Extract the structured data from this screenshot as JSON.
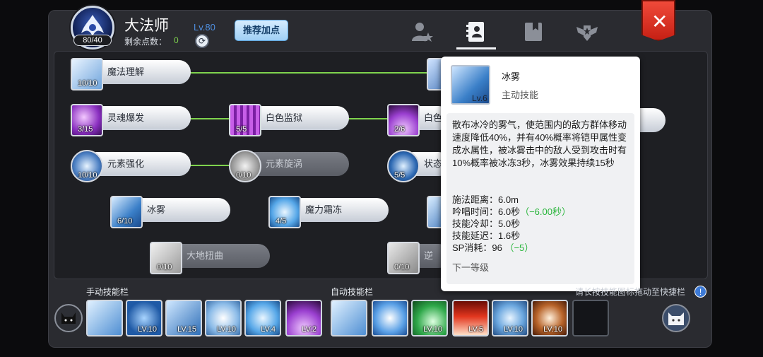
{
  "header": {
    "char_name": "大法师",
    "sp_badge": "80/40",
    "points_label": "剩余点数：",
    "points_value": "0",
    "level": "Lv.80",
    "recommend_label": "推荐加点",
    "close_symbol": "✕"
  },
  "tabs": [
    {
      "name": "character-tab",
      "icon": "person-star-icon",
      "active": false
    },
    {
      "name": "skills-tab",
      "icon": "skill-book-icon",
      "active": true
    },
    {
      "name": "codex-tab",
      "icon": "bookmark-book-icon",
      "active": false
    },
    {
      "name": "emblem-tab",
      "icon": "winged-emblem-icon",
      "active": false
    }
  ],
  "tree": {
    "nodes": [
      {
        "id": "magic-understanding",
        "label": "魔法理解",
        "count": "10/10",
        "disabled": false
      },
      {
        "id": "soul-burst",
        "label": "灵魂爆发",
        "count": "3/15",
        "disabled": false
      },
      {
        "id": "white-prison",
        "label": "白色监狱",
        "count": "5/5",
        "disabled": false
      },
      {
        "id": "white-dome",
        "label": "白色",
        "count": "2/6",
        "disabled": false
      },
      {
        "id": "element-boost",
        "label": "元素强化",
        "count": "10/10",
        "disabled": false
      },
      {
        "id": "element-vortex",
        "label": "元素旋涡",
        "count": "0/10",
        "disabled": true
      },
      {
        "id": "status",
        "label": "状态",
        "count": "5/5",
        "disabled": false
      },
      {
        "id": "ice-mist",
        "label": "冰雾",
        "count": "6/10",
        "disabled": false
      },
      {
        "id": "mana-frost",
        "label": "魔力霜冻",
        "count": "4/5",
        "disabled": false
      },
      {
        "id": "earth-twist",
        "label": "大地扭曲",
        "count": "0/10",
        "disabled": true
      },
      {
        "id": "reverse",
        "label": "逆",
        "count": "0/10",
        "disabled": true
      }
    ]
  },
  "tooltip": {
    "name": "冰雾",
    "type": "主动技能",
    "level": "Lv.6",
    "description": "散布冰冷的雾气，使范围内的敌方群体移动速度降低40%，并有40%概率将铠甲属性变成水属性，被冰雾击中的敌人受到攻击时有10%概率被冰冻3秒，冰雾效果持续15秒",
    "stats": [
      {
        "label": "施法距离：",
        "value": "6.0m",
        "bonus": ""
      },
      {
        "label": "吟唱时间：",
        "value": "6.0秒",
        "bonus": "（−6.00秒）"
      },
      {
        "label": "技能冷却：",
        "value": "5.0秒",
        "bonus": ""
      },
      {
        "label": "技能延迟：",
        "value": "1.6秒",
        "bonus": ""
      },
      {
        "label": "SP消耗：",
        "value": "96",
        "bonus": "（−5）"
      }
    ],
    "next_level": "下一等级"
  },
  "bottom": {
    "manual_label": "手动技能栏",
    "auto_label": "自动技能栏",
    "hint": "请长按技能图标拖动至快捷栏",
    "hint_icon": "!",
    "manual_slots": [
      {
        "icon": "sword-burst-icon",
        "lv": ""
      },
      {
        "icon": "blue-vortex-icon",
        "lv": "LV.10"
      },
      {
        "icon": "ice-cross-icon",
        "lv": "LV.15"
      },
      {
        "icon": "whirl-icon",
        "lv": "LV.10"
      },
      {
        "icon": "snowflake-icon",
        "lv": "LV.4"
      },
      {
        "icon": "purple-dome-icon",
        "lv": "LV.2"
      }
    ],
    "auto_slots": [
      {
        "icon": "sword-burst-icon",
        "lv": ""
      },
      {
        "icon": "blue-shield-icon",
        "lv": ""
      },
      {
        "icon": "green-wave-icon",
        "lv": "LV.10"
      },
      {
        "icon": "red-flame-icon",
        "lv": "LV.5"
      },
      {
        "icon": "blue-ring-icon",
        "lv": "LV.10"
      },
      {
        "icon": "brown-tornado-icon",
        "lv": "LV.10"
      },
      {
        "icon": "empty-slot",
        "lv": ""
      }
    ]
  }
}
